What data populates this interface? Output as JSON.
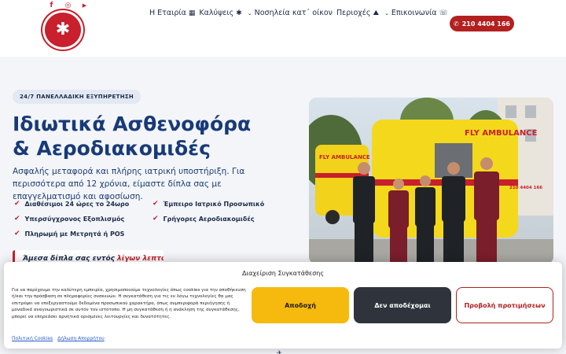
{
  "header": {
    "socials": [
      {
        "icon": "facebook-icon",
        "glyph": "f"
      },
      {
        "icon": "instagram-icon",
        "glyph": "◎"
      },
      {
        "icon": "youtube-icon",
        "glyph": "▶"
      }
    ],
    "logo_icon": "star-of-life-icon",
    "nav": [
      {
        "label": "Η Εταιρία",
        "icon": "building-icon",
        "glyph": "▦"
      },
      {
        "label": "Καλύψεις",
        "icon": "star-of-life-icon",
        "glyph": "✱"
      },
      {
        "label": "Νοσηλεία κατ΄ οίκον",
        "icon": "chevron-down-icon",
        "glyph": "⌄"
      },
      {
        "label": "Περιοχές",
        "icon": "map-pin-icon",
        "glyph": "⛰"
      },
      {
        "label": "Επικοινωνία",
        "icon": "chevron-down-icon",
        "glyph": "⌄"
      }
    ],
    "nav_trailing_icon": "headset-icon",
    "phone": {
      "label": "210 4404 166",
      "icon": "phone-icon"
    }
  },
  "hero": {
    "badge": "24/7 ΠΑΝΕΛΛΑΔΙΚΗ ΕΞΥΠΗΡΕΤΗΣΗ",
    "title_line1": "Ιδιωτικά Ασθενοφόρα",
    "title_line2": "& Αεροδιακομιδές",
    "lead": "Ασφαλής μεταφορά και πλήρης ιατρική υποστήριξη. Για περισσότερα από 12 χρόνια, είμαστε δίπλα σας με επαγγελματισμό και αφοσίωση.",
    "features": [
      "Διαθέσιμοι 24 ώρες το 24ωρο",
      "Έμπειρο Ιατρικό Προσωπικό",
      "Υπερσύγχρονος Εξοπλισμός",
      "Γρήγορες Αεροδιακομιδές",
      "Πληρωμή με Μετρητά ή POS"
    ],
    "quote": "Άμεσα δίπλα σας εντός",
    "quote_accent": "λίγων λεπτών",
    "photo": {
      "vehicle_text": "FLY AMBULANCE",
      "vehicle_text_small": "FLY AMBULANCE",
      "phone_on_van": "210 4404 166"
    }
  },
  "cookie": {
    "title": "Διαχείριση Συγκατάθεσης",
    "text": "Για να παρέχουμε την καλύτερη εμπειρία, χρησιμοποιούμε τεχνολογίες όπως cookies για την αποθήκευση ή/και την πρόσβαση σε πληροφορίες συσκευών. Η συγκατάθεση για τις εν λόγω τεχνολογίες θα μας επιτρέψει να επεξεργαστούμε δεδομένα προσωπικού χαρακτήρα, όπως συμπεριφορά περιήγησης ή μοναδικά αναγνωριστικά σε αυτόν τον ιστότοπο. Η μη συγκατάθεση ή η ανάκληση της συγκατάθεσης, μπορεί να επηρεάσει αρνητικά ορισμένες λειτουργίες και δυνατότητες.",
    "accept": "Αποδοχή",
    "deny": "Δεν αποδέχομαι",
    "prefs": "Προβολή προτιμήσεων",
    "link_policy": "Πολιτική Cookies",
    "link_privacy": "Δήλωση Απορρήτου"
  },
  "colors": {
    "brand_red": "#c8202c",
    "navy": "#183a78",
    "accept_yellow": "#f6b90e",
    "dark": "#2f343c"
  }
}
